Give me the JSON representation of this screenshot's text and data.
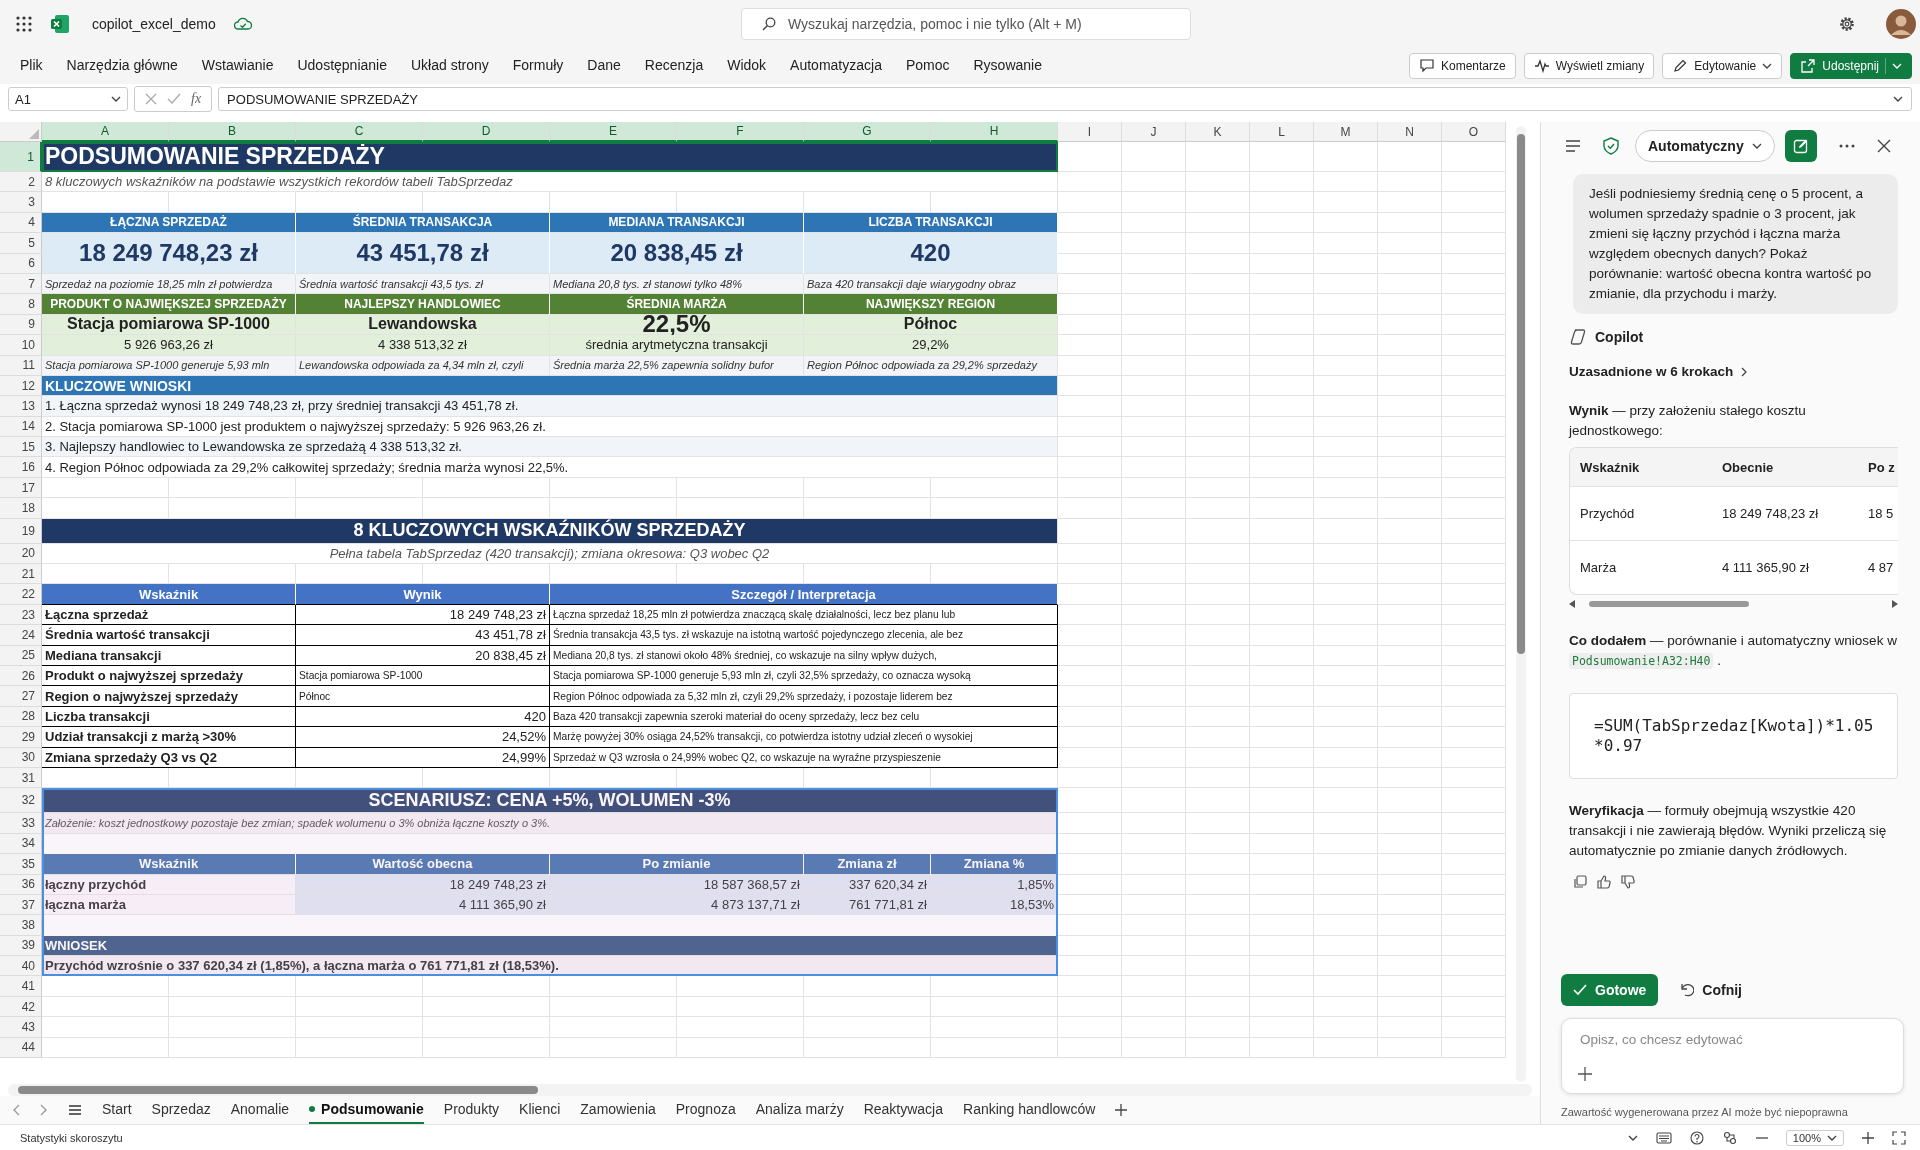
{
  "app": {
    "document_title": "copilot_excel_demo",
    "search": {
      "placeholder": "Wyszukaj narzędzia, pomoc i nie tylko (Alt + M)"
    }
  },
  "ribbon": {
    "tabs": [
      {
        "label": "Plik",
        "selected": false
      },
      {
        "label": "Narzędzia główne",
        "selected": false
      },
      {
        "label": "Wstawianie",
        "selected": false
      },
      {
        "label": "Udostępnianie",
        "selected": false
      },
      {
        "label": "Układ strony",
        "selected": false
      },
      {
        "label": "Formuły",
        "selected": false
      },
      {
        "label": "Dane",
        "selected": false
      },
      {
        "label": "Recenzja",
        "selected": false
      },
      {
        "label": "Widok",
        "selected": false
      },
      {
        "label": "Automatyzacja",
        "selected": false
      },
      {
        "label": "Pomoc",
        "selected": false
      },
      {
        "label": "Rysowanie",
        "selected": false
      }
    ],
    "actions": [
      {
        "label": "Komentarze",
        "kind": "comment"
      },
      {
        "label": "Wyświetl zmiany",
        "kind": "changes"
      },
      {
        "label": "Edytowanie",
        "kind": "edit"
      },
      {
        "label": "Udostępnij",
        "kind": "share"
      }
    ]
  },
  "formula_bar": {
    "name_box": "A1",
    "function_label": "fx",
    "formula": "PODSUMOWANIE SPRZEDAŻY"
  },
  "sheet": {
    "column_letters": [
      {
        "label": "A",
        "selected": true
      },
      {
        "label": "B",
        "selected": true
      },
      {
        "label": "C",
        "selected": true
      },
      {
        "label": "D",
        "selected": true
      },
      {
        "label": "E",
        "selected": true
      },
      {
        "label": "F",
        "selected": true
      },
      {
        "label": "G",
        "selected": true
      },
      {
        "label": "H",
        "selected": true
      },
      {
        "label": "I",
        "selected": false
      },
      {
        "label": "J",
        "selected": false
      },
      {
        "label": "K",
        "selected": false
      },
      {
        "label": "L",
        "selected": false
      },
      {
        "label": "M",
        "selected": false
      },
      {
        "label": "N",
        "selected": false
      },
      {
        "label": "O",
        "selected": false
      }
    ],
    "rows": [
      {
        "number": "1",
        "selected": true,
        "highlighted": false,
        "kind": "title",
        "cells": [
          {
            "text": "PODSUMOWANIE SPRZEDAŻY"
          }
        ]
      },
      {
        "number": "2",
        "selected": false,
        "highlighted": false,
        "kind": "subtitle",
        "cells": [
          {
            "text": "8 kluczowych wskaźników na podstawie wszystkich rekordów tabeli TabSprzedaz"
          }
        ]
      },
      {
        "number": "3",
        "selected": false,
        "highlighted": false,
        "kind": "blank",
        "cells": []
      },
      {
        "number": "4",
        "selected": false,
        "highlighted": false,
        "kind": "kpi-head",
        "cells": [
          {
            "text": "ŁĄCZNA SPRZEDAŻ"
          },
          {
            "text": "ŚREDNIA TRANSAKCJA"
          },
          {
            "text": "MEDIANA TRANSAKCJI"
          },
          {
            "text": "LICZBA TRANSAKCJI"
          }
        ]
      },
      {
        "number": "5",
        "selected": false,
        "highlighted": false,
        "kind": "kpi-value",
        "cells": [
          {
            "text": "18 249 748,23 zł"
          },
          {
            "text": "43 451,78 zł"
          },
          {
            "text": "20 838,45 zł"
          },
          {
            "text": "420"
          }
        ]
      },
      {
        "number": "6",
        "selected": false,
        "highlighted": false,
        "kind": "continued",
        "cells": []
      },
      {
        "number": "7",
        "selected": false,
        "highlighted": false,
        "kind": "kpi-note",
        "cells": [
          {
            "text": "Sprzedaż na poziomie 18,25 mln zł potwierdza"
          },
          {
            "text": "Średnia wartość transakcji 43,5 tys. zł"
          },
          {
            "text": "Mediana 20,8 tys. zł stanowi tylko 48%"
          },
          {
            "text": "Baza 420 transakcji daje wiarygodny obraz"
          }
        ]
      },
      {
        "number": "8",
        "selected": false,
        "highlighted": false,
        "kind": "kpi-head-green",
        "cells": [
          {
            "text": "PRODUKT O NAJWIĘKSZEJ SPRZEDAŻY"
          },
          {
            "text": "NAJLEPSZY HANDLOWIEC"
          },
          {
            "text": "ŚREDNIA MARŻA"
          },
          {
            "text": "NAJWIĘKSZY REGION"
          }
        ]
      },
      {
        "number": "9",
        "selected": false,
        "highlighted": false,
        "kind": "kpi-green-value",
        "cells": [
          {
            "text": "Stacja pomiarowa SP-1000",
            "emphasis": false
          },
          {
            "text": "Lewandowska",
            "emphasis": false
          },
          {
            "text": "22,5%",
            "emphasis": true
          },
          {
            "text": "Północ",
            "emphasis": false
          }
        ]
      },
      {
        "number": "10",
        "selected": false,
        "highlighted": false,
        "kind": "kpi-green-sub",
        "cells": [
          {
            "text": "5 926 963,26 zł"
          },
          {
            "text": "4 338 513,32 zł"
          },
          {
            "text": "średnia arytmetyczna transakcji"
          },
          {
            "text": "29,2%"
          }
        ]
      },
      {
        "number": "11",
        "selected": false,
        "highlighted": false,
        "kind": "kpi-note",
        "cells": [
          {
            "text": "Stacja pomiarowa SP-1000 generuje 5,93 mln"
          },
          {
            "text": "Lewandowska odpowiada za 4,34 mln zł, czyli"
          },
          {
            "text": "Średnia marża 22,5% zapewnia solidny bufor"
          },
          {
            "text": "Region Północ odpowiada za 29,2% sprzedaży"
          }
        ]
      },
      {
        "number": "12",
        "selected": false,
        "highlighted": false,
        "kind": "section",
        "cells": [
          {
            "text": "KLUCZOWE WNIOSKI"
          }
        ]
      },
      {
        "number": "13",
        "selected": false,
        "highlighted": false,
        "kind": "line",
        "shaded": true,
        "cells": [
          {
            "text": "1. Łączna sprzedaż wynosi 18 249 748,23 zł, przy średniej transakcji 43 451,78 zł."
          }
        ]
      },
      {
        "number": "14",
        "selected": false,
        "highlighted": false,
        "kind": "line",
        "shaded": false,
        "cells": [
          {
            "text": "2. Stacja pomiarowa SP-1000 jest produktem o najwyższej sprzedaży: 5 926 963,26 zł."
          }
        ]
      },
      {
        "number": "15",
        "selected": false,
        "highlighted": false,
        "kind": "line",
        "shaded": true,
        "cells": [
          {
            "text": "3. Najlepszy handlowiec to Lewandowska ze sprzedażą 4 338 513,32 zł."
          }
        ]
      },
      {
        "number": "16",
        "selected": false,
        "highlighted": false,
        "kind": "line",
        "shaded": false,
        "cells": [
          {
            "text": "4. Region Północ odpowiada za 29,2% całkowitej sprzedaży; średnia marża wynosi 22,5%."
          }
        ]
      },
      {
        "number": "17",
        "selected": false,
        "highlighted": false,
        "kind": "blank",
        "cells": []
      },
      {
        "number": "18",
        "selected": false,
        "highlighted": false,
        "kind": "blank",
        "cells": []
      },
      {
        "number": "19",
        "selected": false,
        "highlighted": false,
        "kind": "banner",
        "cells": [
          {
            "text": "8 KLUCZOWYCH WSKAŹNIKÓW SPRZEDAŻY"
          }
        ]
      },
      {
        "number": "20",
        "selected": false,
        "highlighted": false,
        "kind": "caption",
        "cells": [
          {
            "text": "Pełna tabela TabSprzedaz (420 transakcji); zmiana okresowa: Q3 wobec Q2"
          }
        ]
      },
      {
        "number": "21",
        "selected": false,
        "highlighted": false,
        "kind": "blank",
        "cells": []
      },
      {
        "number": "22",
        "selected": false,
        "highlighted": false,
        "kind": "table-head",
        "cells": [
          {
            "text": "Wskaźnik"
          },
          {
            "text": "Wynik"
          },
          {
            "text": "Szczegół / Interpretacja"
          }
        ]
      },
      {
        "number": "23",
        "selected": false,
        "highlighted": false,
        "kind": "table-row",
        "cells": [
          {
            "text": "Łączna sprzedaż",
            "numeric": false
          },
          {
            "text": "18 249 748,23 zł",
            "numeric": true
          },
          {
            "text": "Łączna sprzedaż 18,25 mln zł potwierdza znaczącą skalę działalności, lecz bez planu lub",
            "numeric": false
          }
        ]
      },
      {
        "number": "24",
        "selected": false,
        "highlighted": false,
        "kind": "table-row",
        "cells": [
          {
            "text": "Średnia wartość transakcji",
            "numeric": false
          },
          {
            "text": "43 451,78 zł",
            "numeric": true
          },
          {
            "text": "Średnia transakcja 43,5 tys. zł wskazuje na istotną wartość pojedynczego zlecenia, ale bez",
            "numeric": false
          }
        ]
      },
      {
        "number": "25",
        "selected": false,
        "highlighted": false,
        "kind": "table-row",
        "cells": [
          {
            "text": "Mediana transakcji",
            "numeric": false
          },
          {
            "text": "20 838,45 zł",
            "numeric": true
          },
          {
            "text": "Mediana 20,8 tys. zł stanowi około 48% średniej, co wskazuje na silny wpływ dużych,",
            "numeric": false
          }
        ]
      },
      {
        "number": "26",
        "selected": false,
        "highlighted": false,
        "kind": "table-row",
        "cells": [
          {
            "text": "Produkt o najwyższej sprzedaży",
            "numeric": false
          },
          {
            "text": "Stacja pomiarowa SP-1000",
            "numeric": false
          },
          {
            "text": "Stacja pomiarowa SP-1000 generuje 5,93 mln zł, czyli 32,5% sprzedaży, co oznacza wysoką",
            "numeric": false
          }
        ]
      },
      {
        "number": "27",
        "selected": false,
        "highlighted": false,
        "kind": "table-row",
        "cells": [
          {
            "text": "Region o najwyższej sprzedaży",
            "numeric": false
          },
          {
            "text": "Północ",
            "numeric": false
          },
          {
            "text": "Region Północ odpowiada za 5,32 mln zł, czyli 29,2% sprzedaży, i pozostaje liderem bez",
            "numeric": false
          }
        ]
      },
      {
        "number": "28",
        "selected": false,
        "highlighted": false,
        "kind": "table-row",
        "cells": [
          {
            "text": "Liczba transakcji",
            "numeric": false
          },
          {
            "text": "420",
            "numeric": true
          },
          {
            "text": "Baza 420 transakcji zapewnia szeroki materiał do oceny sprzedaży, lecz bez celu",
            "numeric": false
          }
        ]
      },
      {
        "number": "29",
        "selected": false,
        "highlighted": false,
        "kind": "table-row",
        "cells": [
          {
            "text": "Udział transakcji z marżą >30%",
            "numeric": false
          },
          {
            "text": "24,52%",
            "numeric": true
          },
          {
            "text": "Marżę powyżej 30% osiąga 24,52% transakcji, co potwierdza istotny udział zleceń o wysokiej",
            "numeric": false
          }
        ]
      },
      {
        "number": "30",
        "selected": false,
        "highlighted": false,
        "kind": "table-row",
        "cells": [
          {
            "text": "Zmiana sprzedaży Q3 vs Q2",
            "numeric": false
          },
          {
            "text": "24,99%",
            "numeric": true
          },
          {
            "text": "Sprzedaż w Q3 wzrosła o 24,99% wobec Q2, co wskazuje na wyraźne przyspieszenie",
            "numeric": false
          }
        ]
      },
      {
        "number": "31",
        "selected": false,
        "highlighted": false,
        "kind": "blank",
        "cells": []
      },
      {
        "number": "32",
        "selected": false,
        "highlighted": true,
        "kind": "banner",
        "cells": [
          {
            "text": "SCENARIUSZ: CENA +5%, WOLUMEN -3%"
          }
        ]
      },
      {
        "number": "33",
        "selected": false,
        "highlighted": true,
        "kind": "note",
        "cells": [
          {
            "text": "Założenie: koszt jednostkowy pozostaje bez zmian; spadek wolumenu o 3% obniża łączne koszty o 3%."
          }
        ]
      },
      {
        "number": "34",
        "selected": false,
        "highlighted": true,
        "kind": "blank",
        "cells": []
      },
      {
        "number": "35",
        "selected": false,
        "highlighted": true,
        "kind": "scen-head",
        "cells": [
          {
            "text": "Wskaźnik"
          },
          {
            "text": "Wartość obecna"
          },
          {
            "text": "Po zmianie"
          },
          {
            "text": "Zmiana zł"
          },
          {
            "text": "Zmiana %"
          }
        ]
      },
      {
        "number": "36",
        "selected": false,
        "highlighted": true,
        "kind": "scen-row",
        "cells": [
          {
            "text": "łączny przychód",
            "numeric": false
          },
          {
            "text": "18 249 748,23 zł",
            "numeric": true
          },
          {
            "text": "18 587 368,57 zł",
            "numeric": true
          },
          {
            "text": "337 620,34 zł",
            "numeric": true
          },
          {
            "text": "1,85%",
            "numeric": true
          }
        ]
      },
      {
        "number": "37",
        "selected": false,
        "highlighted": true,
        "kind": "scen-row",
        "cells": [
          {
            "text": "łączna marża",
            "numeric": false
          },
          {
            "text": "4 111 365,90 zł",
            "numeric": true
          },
          {
            "text": "4 873 137,71 zł",
            "numeric": true
          },
          {
            "text": "761 771,81 zł",
            "numeric": true
          },
          {
            "text": "18,53%",
            "numeric": true
          }
        ]
      },
      {
        "number": "38",
        "selected": false,
        "highlighted": true,
        "kind": "blank",
        "cells": []
      },
      {
        "number": "39",
        "selected": false,
        "highlighted": true,
        "kind": "section-dark",
        "cells": [
          {
            "text": "WNIOSEK"
          }
        ]
      },
      {
        "number": "40",
        "selected": false,
        "highlighted": true,
        "kind": "conclusion",
        "cells": [
          {
            "text": "Przychód wzrośnie o 337 620,34 zł (1,85%), a łączna marża o 761 771,81 zł (18,53%)."
          }
        ]
      },
      {
        "number": "41",
        "selected": false,
        "highlighted": false,
        "kind": "blank",
        "cells": []
      },
      {
        "number": "42",
        "selected": false,
        "highlighted": false,
        "kind": "blank",
        "cells": []
      },
      {
        "number": "43",
        "selected": false,
        "highlighted": false,
        "kind": "blank",
        "cells": []
      },
      {
        "number": "44",
        "selected": false,
        "highlighted": false,
        "kind": "blank",
        "cells": []
      }
    ]
  },
  "sheet_tabs": [
    {
      "label": "Start",
      "selected": false
    },
    {
      "label": "Sprzedaz",
      "selected": false
    },
    {
      "label": "Anomalie",
      "selected": false
    },
    {
      "label": "Podsumowanie",
      "selected": true
    },
    {
      "label": "Produkty",
      "selected": false
    },
    {
      "label": "Klienci",
      "selected": false
    },
    {
      "label": "Zamowienia",
      "selected": false
    },
    {
      "label": "Prognoza",
      "selected": false
    },
    {
      "label": "Analiza marży",
      "selected": false
    },
    {
      "label": "Reaktywacja",
      "selected": false
    },
    {
      "label": "Ranking handlowców",
      "selected": false
    }
  ],
  "copilot": {
    "mode": "Automatyczny",
    "prompt": "Jeśli podniesiemy średnią cenę o 5 procent, a wolumen sprzedaży spadnie o 3 procent, jak zmieni się łączny przychód i łączna marża względem obecnych danych? Pokaż porównanie: wartość obecna kontra wartość po zmianie, dla przychodu i marży.",
    "author": "Copilot",
    "reasoning_link": "Uzasadnione w 6 krokach",
    "result_intro": "**Wynik** — przy założeniu stałego kosztu jednostkowego:",
    "table": {
      "columns": [
        "Wskaźnik",
        "Obecnie",
        "Po z"
      ],
      "rows": [
        [
          "Przychód",
          "18 249 748,23 zł",
          "18 5"
        ],
        [
          "Marża",
          "4 111 365,90 zł",
          "4 87"
        ]
      ]
    },
    "added": {
      "text": "**Co dodałem** — porównanie i automatyczny wniosek w",
      "code": "Podsumowanie!A32:H40",
      "end": "."
    },
    "formula": "=SUM(TabSprzedaz[Kwota])*1.05*0.97",
    "verification": "**Weryfikacja** — formuły obejmują wszystkie 420 transakcji i nie zawierają błędów. Wyniki przeliczą się automatycznie po zmianie danych źródłowych.",
    "buttons": [
      {
        "label": "Gotowe",
        "kind": "primary"
      },
      {
        "label": "Cofnij",
        "kind": "undo"
      }
    ],
    "input": {
      "placeholder": "Opisz, co chcesz edytować"
    },
    "disclaimer": "Zawartość wygenerowana przez AI może być niepoprawna"
  },
  "status_bar": {
    "text": "Statystyki skoroszytu",
    "zoom": "100%"
  }
}
